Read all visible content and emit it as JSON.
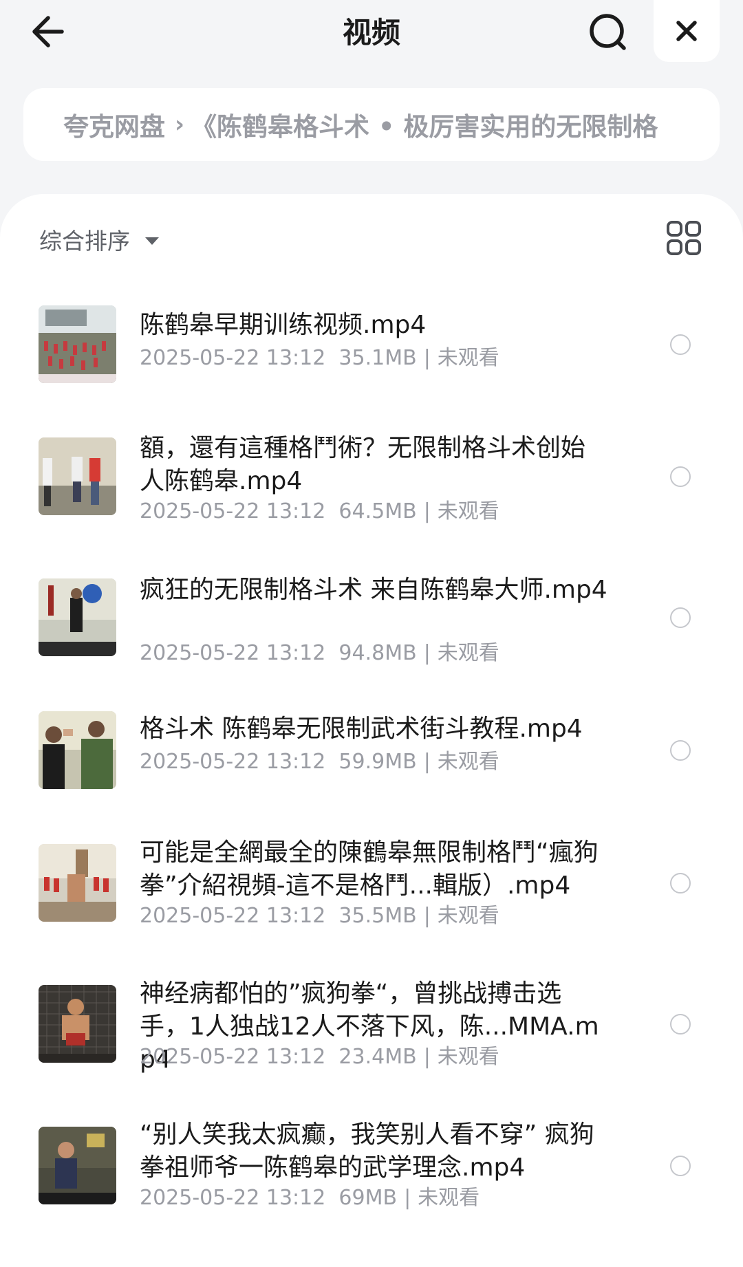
{
  "header": {
    "title": "视频",
    "back_icon": "arrow-left-icon",
    "search_icon": "search-icon",
    "close_icon": "close-icon"
  },
  "breadcrumb": {
    "root": "夸克网盘",
    "separator": "›",
    "current": "《陈鹤皋格斗术 • 极厉害实用的无限制格"
  },
  "toolbar": {
    "sort_label": "综合排序",
    "view_toggle_icon": "grid-view-icon"
  },
  "files": [
    {
      "name": "陈鹤皋早期训练视频.mp4",
      "date": "2025-05-22 13:12",
      "size": "35.1MB",
      "status": "未观看"
    },
    {
      "name": "額，還有這種格鬥術？无限制格斗术创始人陈鹤皋.mp4",
      "date": "2025-05-22 13:12",
      "size": "64.5MB",
      "status": "未观看"
    },
    {
      "name": "疯狂的无限制格斗术 来自陈鹤皋大师.mp4",
      "date": "2025-05-22 13:12",
      "size": "94.8MB",
      "status": "未观看"
    },
    {
      "name": "格斗术 陈鹤皋无限制武术街斗教程.mp4",
      "date": "2025-05-22 13:12",
      "size": "59.9MB",
      "status": "未观看"
    },
    {
      "name": "可能是全網最全的陳鶴皋無限制格鬥“瘋狗拳”介紹視頻-這不是格鬥...輯版）.mp4",
      "date": "2025-05-22 13:12",
      "size": "35.5MB",
      "status": "未观看"
    },
    {
      "name": "神经病都怕的”疯狗拳“，曾挑战搏击选手，1人独战12人不落下风，陈...MMA.mp4",
      "date": "2025-05-22 13:12",
      "size": "23.4MB",
      "status": "未观看"
    },
    {
      "name": "“别人笑我太疯癫，我笑别人看不穿” 疯狗拳祖师爷一陈鹤皋的武学理念.mp4",
      "date": "2025-05-22 13:12",
      "size": "69MB",
      "status": "未观看"
    }
  ]
}
